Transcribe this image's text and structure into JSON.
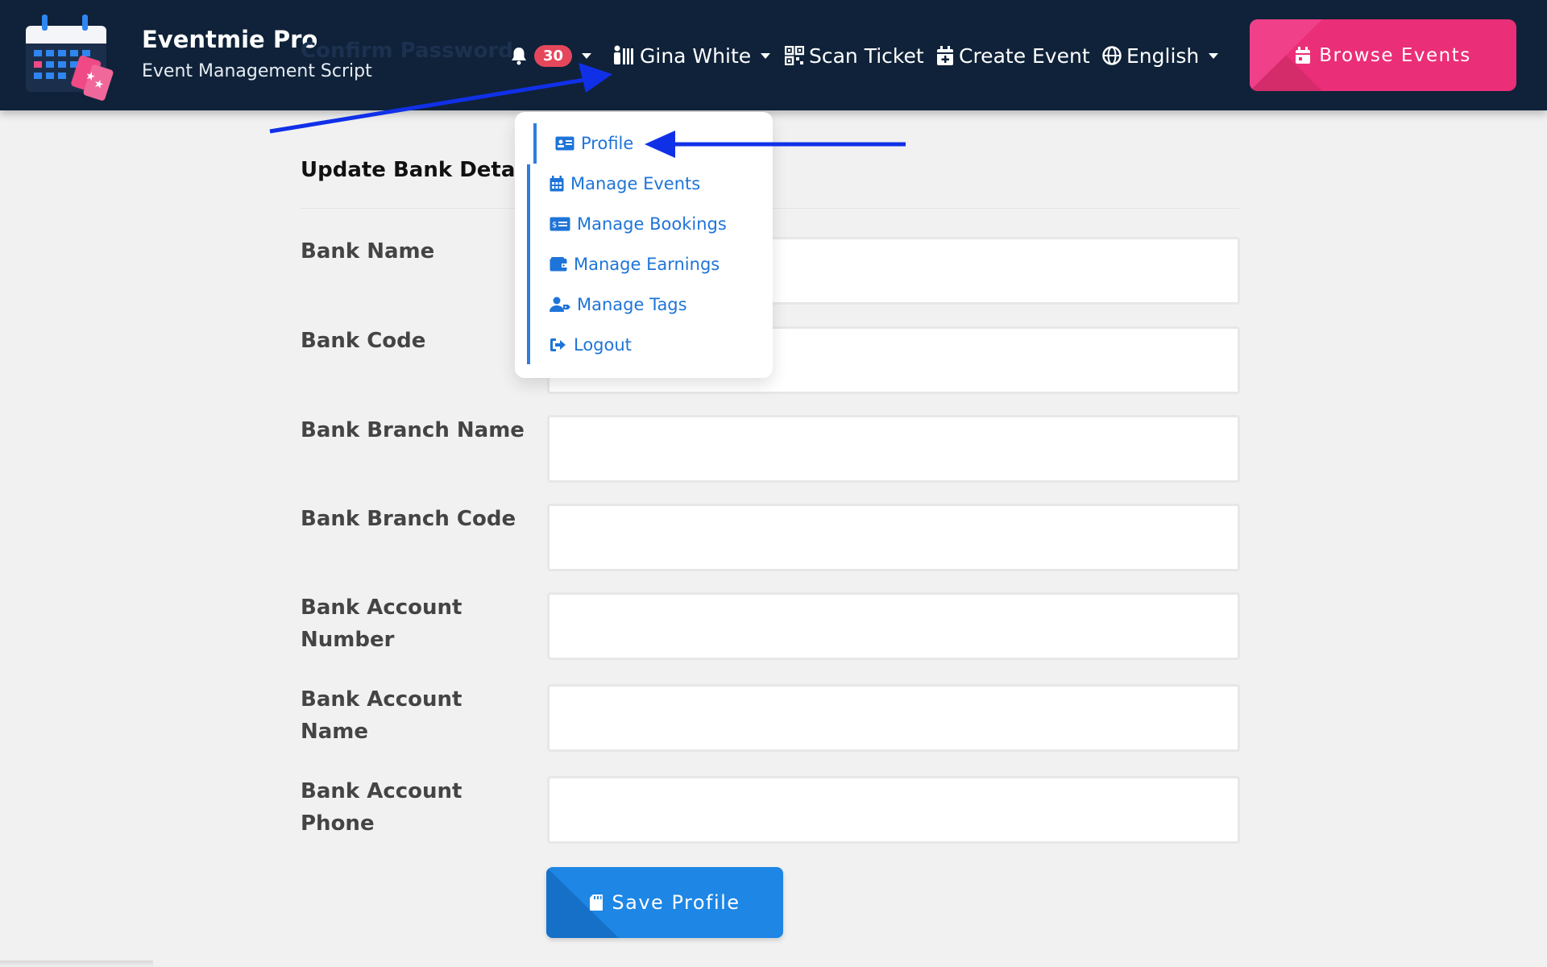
{
  "brand": {
    "name": "Eventmie Pro",
    "tagline": "Event Management Script"
  },
  "background_heading": "Confirm Password",
  "navbar": {
    "notification_count": "30",
    "user_name": "Gina White",
    "scan_ticket": "Scan Ticket",
    "create_event": "Create Event",
    "language": "English",
    "browse_events": "Browse Events"
  },
  "user_menu": {
    "items": [
      {
        "label": "Profile",
        "icon": "id-card-icon"
      },
      {
        "label": "Manage Events",
        "icon": "calendar-icon"
      },
      {
        "label": "Manage Bookings",
        "icon": "money-card-icon"
      },
      {
        "label": "Manage Earnings",
        "icon": "wallet-icon"
      },
      {
        "label": "Manage Tags",
        "icon": "user-tag-icon"
      },
      {
        "label": "Logout",
        "icon": "logout-icon"
      }
    ]
  },
  "form": {
    "title": "Update Bank Details",
    "fields": [
      {
        "label": "Bank Name",
        "value": ""
      },
      {
        "label": "Bank Code",
        "value": ""
      },
      {
        "label": "Bank Branch Name",
        "value": ""
      },
      {
        "label": "Bank Branch Code",
        "value": ""
      },
      {
        "label_line1": "Bank Account",
        "label_line2": "Number",
        "value": ""
      },
      {
        "label_line1": "Bank Account",
        "label_line2": "Name",
        "value": ""
      },
      {
        "label_line1": "Bank Account",
        "label_line2": "Phone",
        "value": ""
      }
    ],
    "save_label": "Save Profile"
  },
  "colors": {
    "navbar": "#0f2239",
    "accent_pink": "#ea2e77",
    "accent_blue": "#1e86e5",
    "link_blue": "#1e74d8",
    "annotation_arrow": "#1030e8"
  }
}
